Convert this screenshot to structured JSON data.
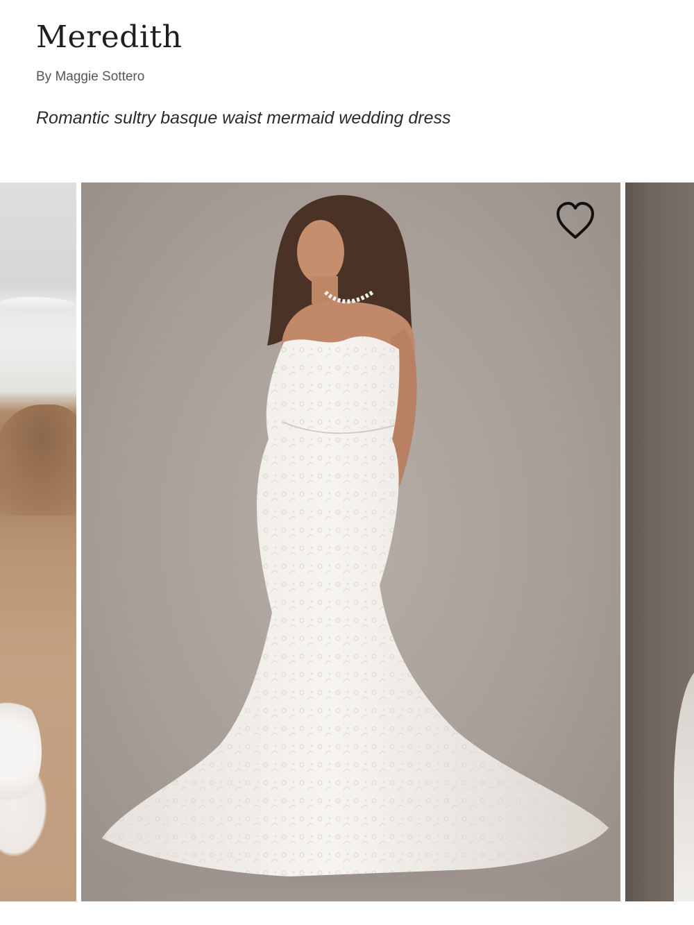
{
  "product": {
    "name": "Meredith",
    "designer": "By Maggie Sottero",
    "tagline": "Romantic sultry basque waist mermaid wedding dress"
  },
  "gallery": {
    "slides": [
      {
        "subject": "bride on sandy beach with ocean waves"
      },
      {
        "subject": "model in strapless lace mermaid gown with pearl necklace"
      },
      {
        "subject": "dress detail against dark background"
      }
    ],
    "active_slide": 2
  },
  "icons": {
    "favorite": "heart-outline-icon"
  },
  "colors": {
    "text_primary": "#1f1f1f",
    "text_secondary": "#555555",
    "studio_backdrop": "#a99f99",
    "gown": "#f2efec",
    "sand": "#b89474"
  }
}
